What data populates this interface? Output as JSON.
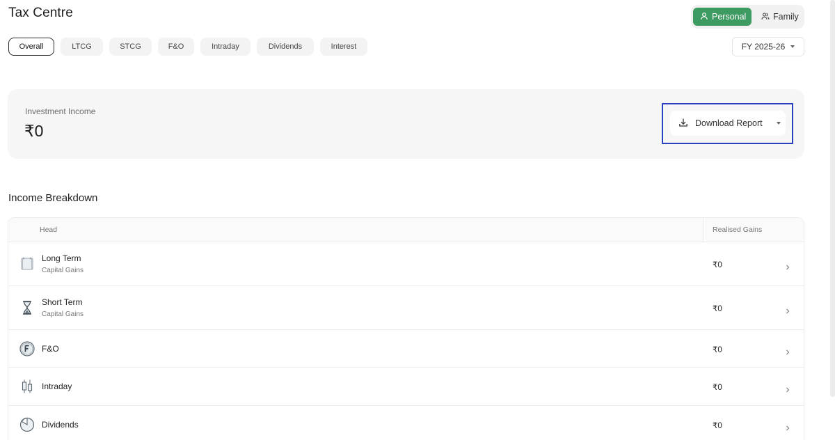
{
  "page": {
    "title": "Tax Centre"
  },
  "view_toggle": {
    "personal": "Personal",
    "family": "Family",
    "active": "Personal"
  },
  "tabs": [
    {
      "label": "Overall",
      "active": true
    },
    {
      "label": "LTCG",
      "active": false
    },
    {
      "label": "STCG",
      "active": false
    },
    {
      "label": "F&O",
      "active": false
    },
    {
      "label": "Intraday",
      "active": false
    },
    {
      "label": "Dividends",
      "active": false
    },
    {
      "label": "Interest",
      "active": false
    }
  ],
  "fy_select": {
    "value": "FY 2025-26"
  },
  "investment": {
    "label": "Investment Income",
    "value": "₹0",
    "download_label": "Download Report"
  },
  "breakdown": {
    "title": "Income Breakdown",
    "columns": {
      "head": "Head",
      "gains": "Realised Gains"
    },
    "rows": [
      {
        "name": "Long Term",
        "sub": "Capital Gains",
        "value": "₹0",
        "icon": "calendar-icon"
      },
      {
        "name": "Short Term",
        "sub": "Capital Gains",
        "value": "₹0",
        "icon": "hourglass-icon"
      },
      {
        "name": "F&O",
        "value": "₹0",
        "icon": "fo-coin-icon"
      },
      {
        "name": "Intraday",
        "value": "₹0",
        "icon": "candlestick-icon"
      },
      {
        "name": "Dividends",
        "value": "₹0",
        "icon": "pie-chart-icon"
      }
    ]
  },
  "colors": {
    "accent_green": "#3d9a61",
    "highlight_blue": "#2b3fc0"
  }
}
